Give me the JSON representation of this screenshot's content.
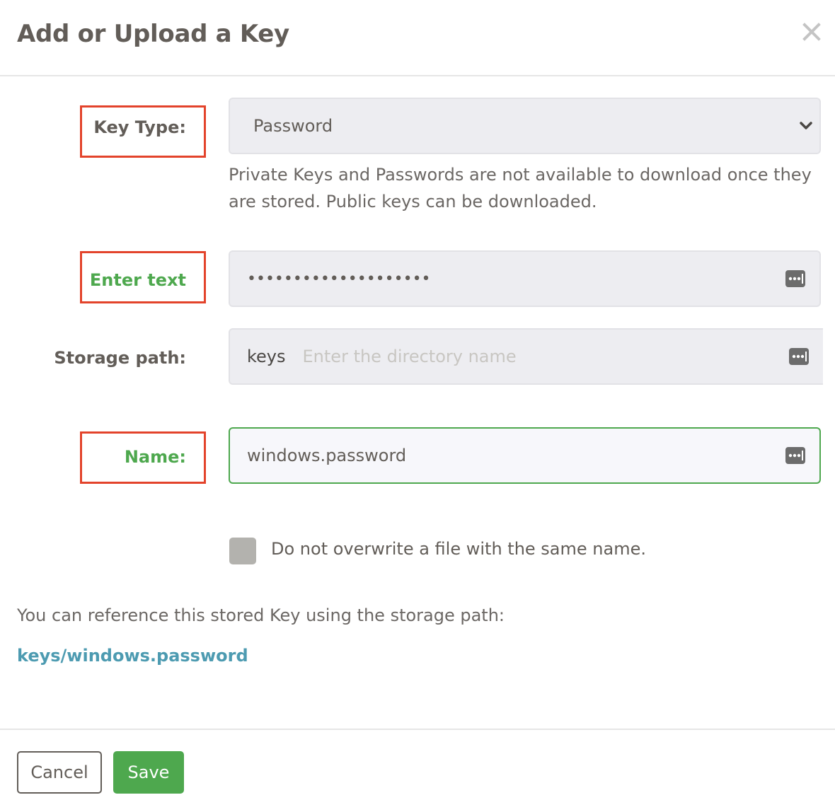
{
  "dialog": {
    "title": "Add or Upload a Key",
    "close_icon": "close-icon"
  },
  "form": {
    "key_type": {
      "label": "Key Type:",
      "selected": "Password",
      "icon": "chevron-down-icon",
      "help": "Private Keys and Passwords are not available to download once they are stored. Public keys can be downloaded."
    },
    "enter_text": {
      "label": "Enter text",
      "masked_value": "••••••••••••••••••••",
      "icon": "password-manager-icon"
    },
    "storage_path": {
      "label": "Storage path:",
      "prefix": "keys",
      "placeholder": "Enter the directory name",
      "icon": "password-manager-icon"
    },
    "name": {
      "label": "Name:",
      "value": "windows.password",
      "icon": "password-manager-icon"
    },
    "overwrite_checkbox": {
      "label": "Do not overwrite a file with the same name.",
      "checked": false
    }
  },
  "reference": {
    "text": "You can reference this stored Key using the storage path:",
    "path": "keys/windows.password"
  },
  "footer": {
    "cancel_label": "Cancel",
    "save_label": "Save"
  },
  "colors": {
    "accent_green": "#4ea84e",
    "highlight_red": "#e3432b",
    "link_blue": "#4d9bb1",
    "text_gray": "#625d58"
  }
}
